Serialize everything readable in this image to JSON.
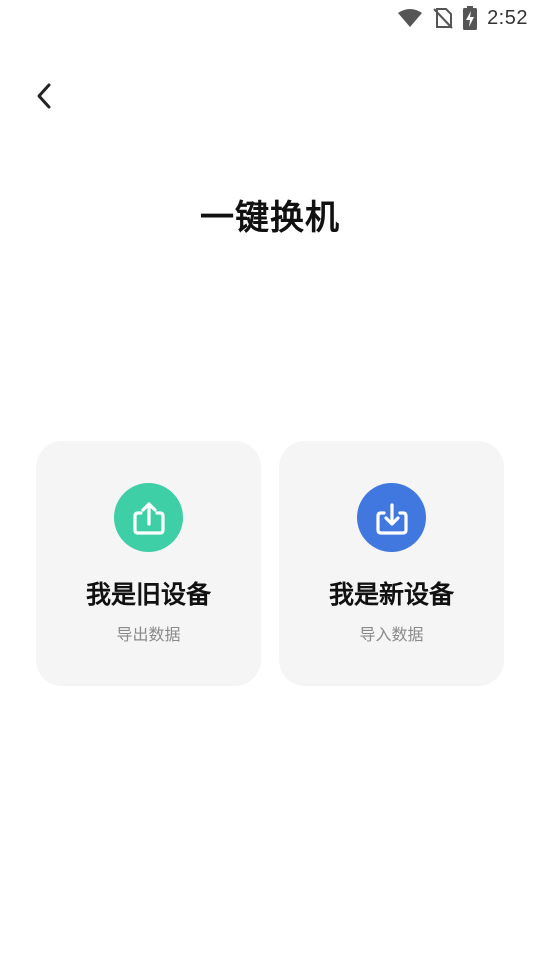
{
  "status_bar": {
    "time": "2:52",
    "icons": [
      "wifi-icon",
      "no-sim-icon",
      "battery-charging-icon"
    ]
  },
  "header": {
    "back_icon": "chevron-left-icon",
    "title": "一键换机"
  },
  "cards": [
    {
      "title": "我是旧设备",
      "subtitle": "导出数据",
      "icon": "upload-icon",
      "color": "#3ecfa7"
    },
    {
      "title": "我是新设备",
      "subtitle": "导入数据",
      "icon": "download-icon",
      "color": "#4178e0"
    }
  ]
}
